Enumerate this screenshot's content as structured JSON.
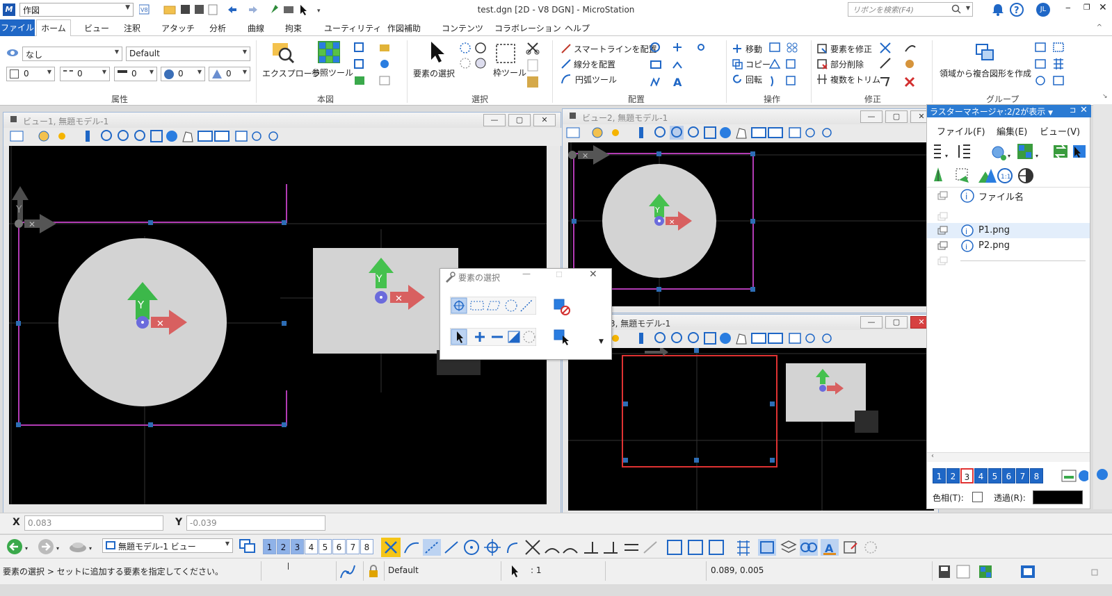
{
  "app": {
    "title": "test.dgn [2D - V8 DGN] - MicroStation",
    "workflow": "作図",
    "ribbon_search_placeholder": "リボンを検索(F4)",
    "user_initials": "JL"
  },
  "menu": [
    "ファイル",
    "ホーム",
    "ビュー",
    "注釈",
    "アタッチ",
    "分析",
    "曲線",
    "拘束",
    "ユーティリティ",
    "作図補助",
    "コンテンツ",
    "コラボレーション",
    "ヘルプ"
  ],
  "ribbon": {
    "attributes": {
      "level": "なし",
      "style": "Default",
      "color": "0",
      "weight": "0",
      "linestyle": "0",
      "transparency": "0",
      "priority": "0",
      "group_label": "属性"
    },
    "primary": {
      "explorer": "エクスプローラ",
      "reference": "参照ツール",
      "group_label": "本図"
    },
    "selection": {
      "select": "要素の選択",
      "fence": "枠ツール",
      "group_label": "選択"
    },
    "placement": {
      "smartline": "スマートラインを配置",
      "line": "線分を配置",
      "arc": "円弧ツール",
      "group_label": "配置"
    },
    "manipulate": {
      "move": "移動",
      "copy": "コピー",
      "rotate": "回転",
      "group_label": "操作"
    },
    "modify": {
      "modify": "要素を修正",
      "partial_delete": "部分削除",
      "trim_multiple": "複数をトリム",
      "group_label": "修正"
    },
    "groups": {
      "region": "領域から複合図形を作成",
      "group_label": "グループ"
    }
  },
  "views": [
    {
      "title": "ビュー1, 無題モデル-1"
    },
    {
      "title": "ビュー2, 無題モデル-1"
    },
    {
      "title": "3, 無題モデル-1"
    }
  ],
  "raster_manager": {
    "title": "ラスターマネージャ:2/2が表示",
    "menu": [
      "ファイル(F)",
      "編集(E)",
      "ビュー(V)"
    ],
    "column_header": "ファイル名",
    "files": [
      "P1.png",
      "P2.png"
    ],
    "view_numbers": [
      "1",
      "2",
      "3",
      "4",
      "5",
      "6",
      "7",
      "8"
    ],
    "selected_view": "3",
    "tint_label": "色相(T):",
    "transparency_label": "透過(R):"
  },
  "select_dialog": {
    "title": "要素の選択"
  },
  "coordinates": {
    "x_label": "X",
    "x_value": "0.083",
    "y_label": "Y",
    "y_value": "-0.039"
  },
  "view_toolbar": {
    "model_view": "無題モデル-1 ビュー",
    "view_numbers": [
      "1",
      "2",
      "3",
      "4",
      "5",
      "6",
      "7",
      "8"
    ],
    "active_views": [
      "1",
      "2",
      "3"
    ]
  },
  "status": {
    "prompt": "要素の選択 > セットに追加する要素を指定してください。",
    "level": "Default",
    "selection_count": ": 1",
    "cursor_coords": "0.089, 0.005"
  },
  "colors": {
    "accent": "#2b7bd3",
    "file_tab": "#1f67c6",
    "fence_red": "#e03232",
    "element_magenta": "#b23bb4",
    "circle_fill": "#d3d3d3"
  }
}
